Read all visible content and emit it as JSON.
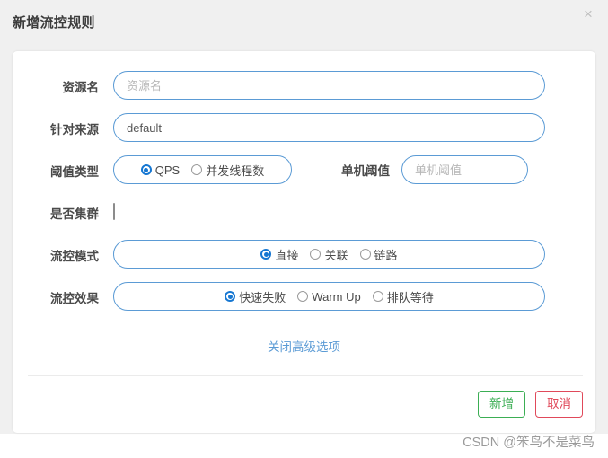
{
  "dialog": {
    "title": "新增流控规则",
    "close_icon": "×"
  },
  "form": {
    "resource": {
      "label": "资源名",
      "placeholder": "资源名",
      "value": ""
    },
    "origin": {
      "label": "针对来源",
      "placeholder": "",
      "value": "default"
    },
    "threshold_type": {
      "label": "阈值类型",
      "options": [
        {
          "label": "QPS",
          "selected": true
        },
        {
          "label": "并发线程数",
          "selected": false
        }
      ]
    },
    "single_threshold": {
      "label": "单机阈值",
      "placeholder": "单机阈值",
      "value": ""
    },
    "cluster": {
      "label": "是否集群",
      "checked": false
    },
    "flow_mode": {
      "label": "流控模式",
      "options": [
        {
          "label": "直接",
          "selected": true
        },
        {
          "label": "关联",
          "selected": false
        },
        {
          "label": "链路",
          "selected": false
        }
      ]
    },
    "flow_effect": {
      "label": "流控效果",
      "options": [
        {
          "label": "快速失败",
          "selected": true
        },
        {
          "label": "Warm Up",
          "selected": false
        },
        {
          "label": "排队等待",
          "selected": false
        }
      ]
    },
    "advanced_link": "关闭高级选项"
  },
  "footer": {
    "add_label": "新增",
    "cancel_label": "取消"
  },
  "watermark": "CSDN @笨鸟不是菜鸟",
  "colors": {
    "input_border": "#5b9bd5",
    "radio_accent": "#1677d2",
    "link": "#5b9bd5",
    "add_button": "#3bae54",
    "cancel_button": "#e0495a",
    "dialog_bg": "#f0f0f0"
  }
}
